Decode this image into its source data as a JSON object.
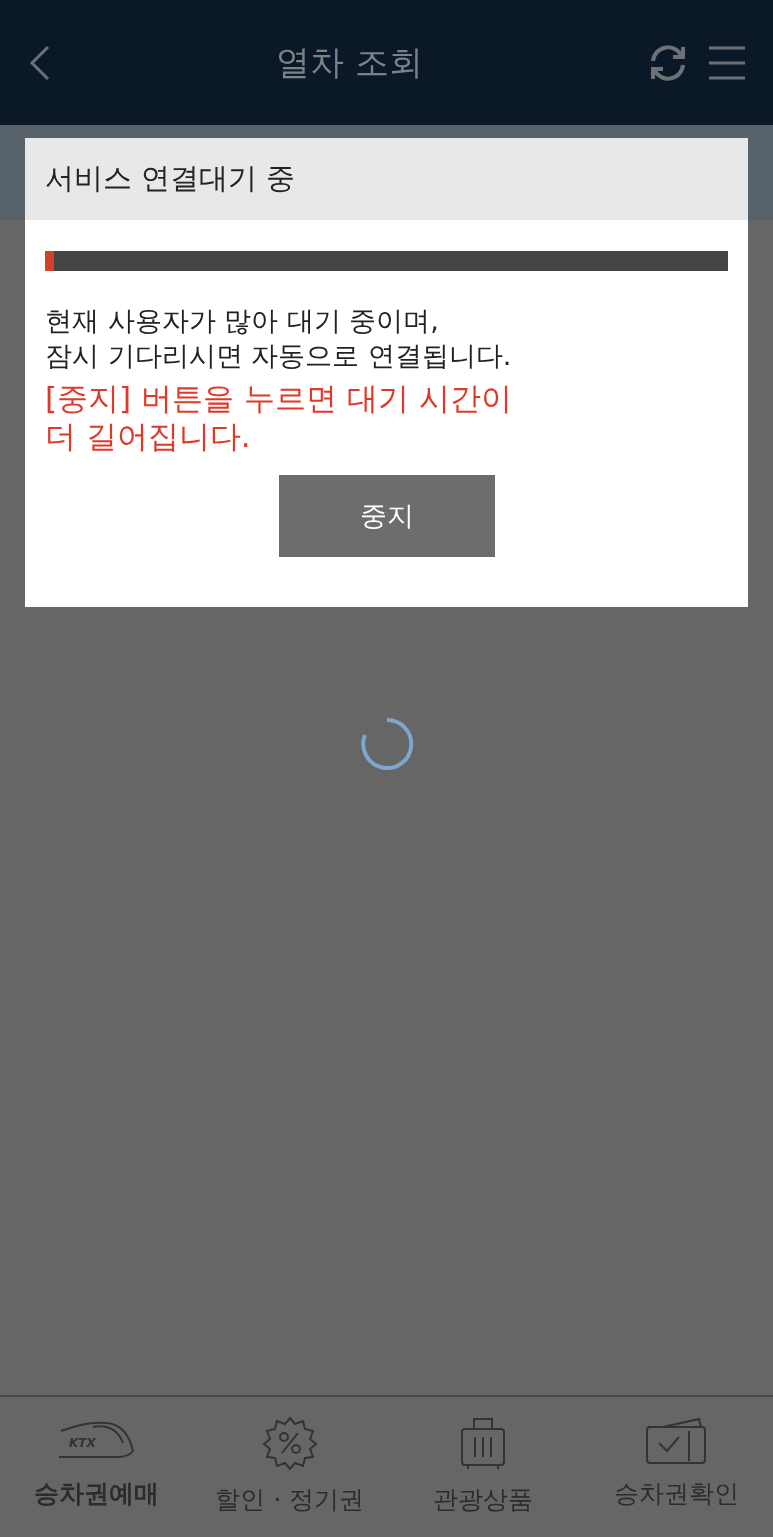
{
  "header": {
    "title": "열차 조회"
  },
  "dialog": {
    "title": "서비스 연결대기 중",
    "progress": {
      "level": 0.013
    },
    "message": [
      "현재 사용자가 많아 대기 중이며,",
      "잠시 기다리시면 자동으로 연결됩니다."
    ],
    "warning": [
      "[중지] 버튼을 누르면 대기 시간이",
      "더 길어집니다."
    ],
    "button": "중지"
  },
  "loading": true,
  "tabs": [
    {
      "kind": "train",
      "label": "승차권예매",
      "logo_text": "KTX",
      "selected": true
    },
    {
      "kind": "discount",
      "label": "할인 · 정기권",
      "selected": false
    },
    {
      "kind": "luggage",
      "label": "관광상품",
      "selected": false
    },
    {
      "kind": "ticket",
      "label": "승차권확인",
      "selected": false
    }
  ]
}
